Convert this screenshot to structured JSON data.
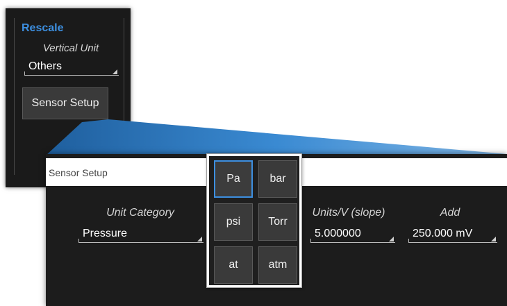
{
  "rescale_panel": {
    "title": "Rescale",
    "vertical_unit_label": "Vertical Unit",
    "vertical_unit_value": "Others",
    "sensor_setup_button": "Sensor Setup"
  },
  "dialog": {
    "title": "Sensor Setup",
    "unit_category_label": "Unit Category",
    "unit_category_value": "Pressure",
    "units_per_volt_label": "Units/V (slope)",
    "units_per_volt_value": "5.000000",
    "add_label": "Add",
    "add_value": "250.000 mV"
  },
  "unit_popup": {
    "units": [
      "Pa",
      "bar",
      "psi",
      "Torr",
      "at",
      "atm"
    ],
    "selected": "Pa"
  },
  "colors": {
    "accent": "#3d8fe0",
    "panel_bg": "#1a1a1a",
    "button_bg": "#3a3a3a"
  }
}
